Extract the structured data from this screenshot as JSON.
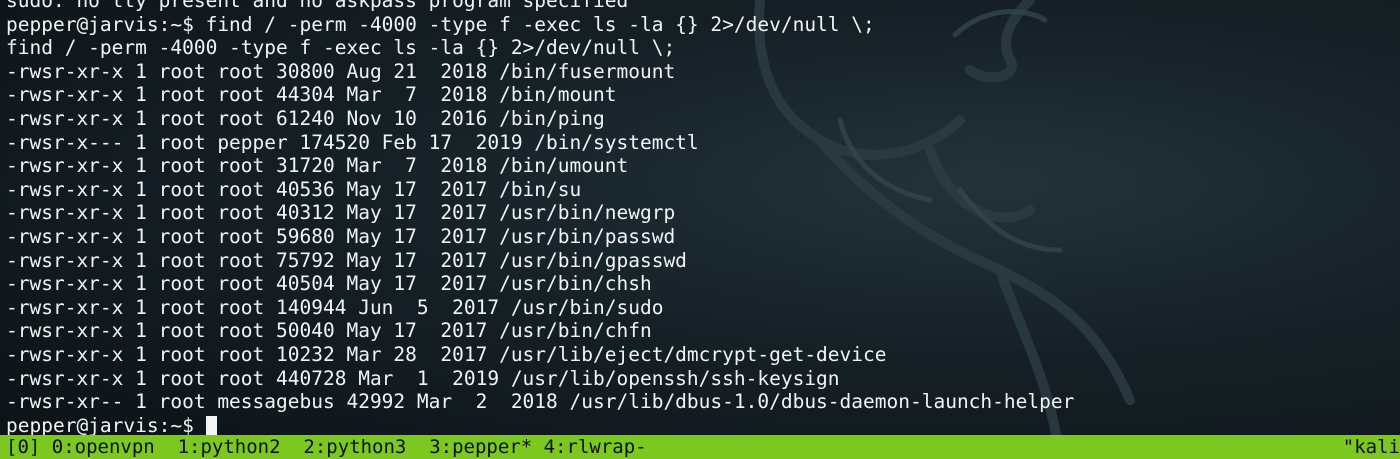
{
  "terminal": {
    "lines": [
      "sudo: no tty present and no askpass program specified",
      "pepper@jarvis:~$ find / -perm -4000 -type f -exec ls -la {} 2>/dev/null \\;",
      "find / -perm -4000 -type f -exec ls -la {} 2>/dev/null \\;",
      "-rwsr-xr-x 1 root root 30800 Aug 21  2018 /bin/fusermount",
      "-rwsr-xr-x 1 root root 44304 Mar  7  2018 /bin/mount",
      "-rwsr-xr-x 1 root root 61240 Nov 10  2016 /bin/ping",
      "-rwsr-x--- 1 root pepper 174520 Feb 17  2019 /bin/systemctl",
      "-rwsr-xr-x 1 root root 31720 Mar  7  2018 /bin/umount",
      "-rwsr-xr-x 1 root root 40536 May 17  2017 /bin/su",
      "-rwsr-xr-x 1 root root 40312 May 17  2017 /usr/bin/newgrp",
      "-rwsr-xr-x 1 root root 59680 May 17  2017 /usr/bin/passwd",
      "-rwsr-xr-x 1 root root 75792 May 17  2017 /usr/bin/gpasswd",
      "-rwsr-xr-x 1 root root 40504 May 17  2017 /usr/bin/chsh",
      "-rwsr-xr-x 1 root root 140944 Jun  5  2017 /usr/bin/sudo",
      "-rwsr-xr-x 1 root root 50040 May 17  2017 /usr/bin/chfn",
      "-rwsr-xr-x 1 root root 10232 Mar 28  2017 /usr/lib/eject/dmcrypt-get-device",
      "-rwsr-xr-x 1 root root 440728 Mar  1  2019 /usr/lib/openssh/ssh-keysign",
      "-rwsr-xr-- 1 root messagebus 42992 Mar  2  2018 /usr/lib/dbus-1.0/dbus-daemon-launch-helper"
    ],
    "prompt": "pepper@jarvis:~$ "
  },
  "statusbar": {
    "windows": "[0] 0:openvpn  1:python2  2:python3  3:pepper* 4:rlwrap-",
    "right": "\"kali"
  },
  "colors": {
    "background": "#152026",
    "text": "#f2f4f5",
    "statusbar": "#7cc81f"
  },
  "background_icon": "kali-dragon-icon"
}
